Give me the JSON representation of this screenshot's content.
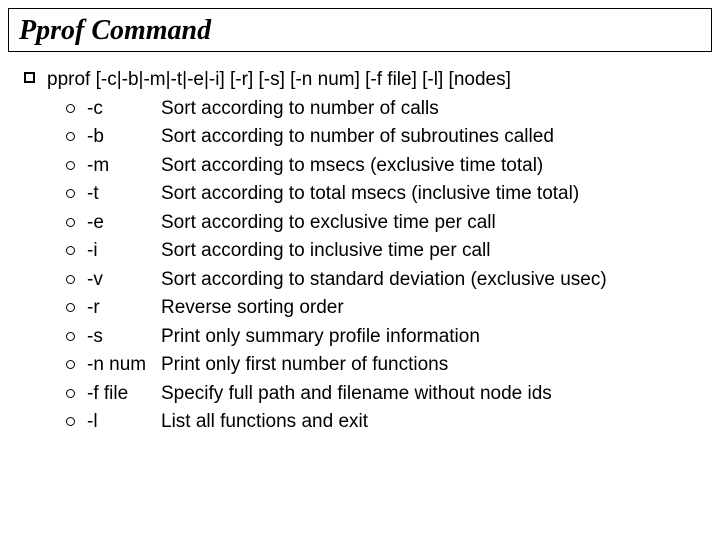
{
  "title": "Pprof Command",
  "usage": "pprof [-c|-b|-m|-t|-e|-i] [-r] [-s] [-n num] [-f file] [-l] [nodes]",
  "options": [
    {
      "flag": "-c",
      "desc": "Sort according to number of calls"
    },
    {
      "flag": "-b",
      "desc": "Sort according to number of subroutines called"
    },
    {
      "flag": "-m",
      "desc": "Sort according to msecs (exclusive time total)"
    },
    {
      "flag": "-t",
      "desc": "Sort according to total msecs (inclusive time total)"
    },
    {
      "flag": "-e",
      "desc": "Sort according to exclusive time per call"
    },
    {
      "flag": "-i",
      "desc": "Sort according to inclusive time per call"
    },
    {
      "flag": "-v",
      "desc": "Sort according to standard deviation (exclusive usec)"
    },
    {
      "flag": "-r",
      "desc": "Reverse sorting order"
    },
    {
      "flag": "-s",
      "desc": "Print only summary profile information"
    },
    {
      "flag": "-n num",
      "desc": "Print only first number of functions"
    },
    {
      "flag": "-f file",
      "desc": "Specify full path and filename without node ids"
    },
    {
      "flag": "-l",
      "desc": "List all functions and exit"
    }
  ]
}
